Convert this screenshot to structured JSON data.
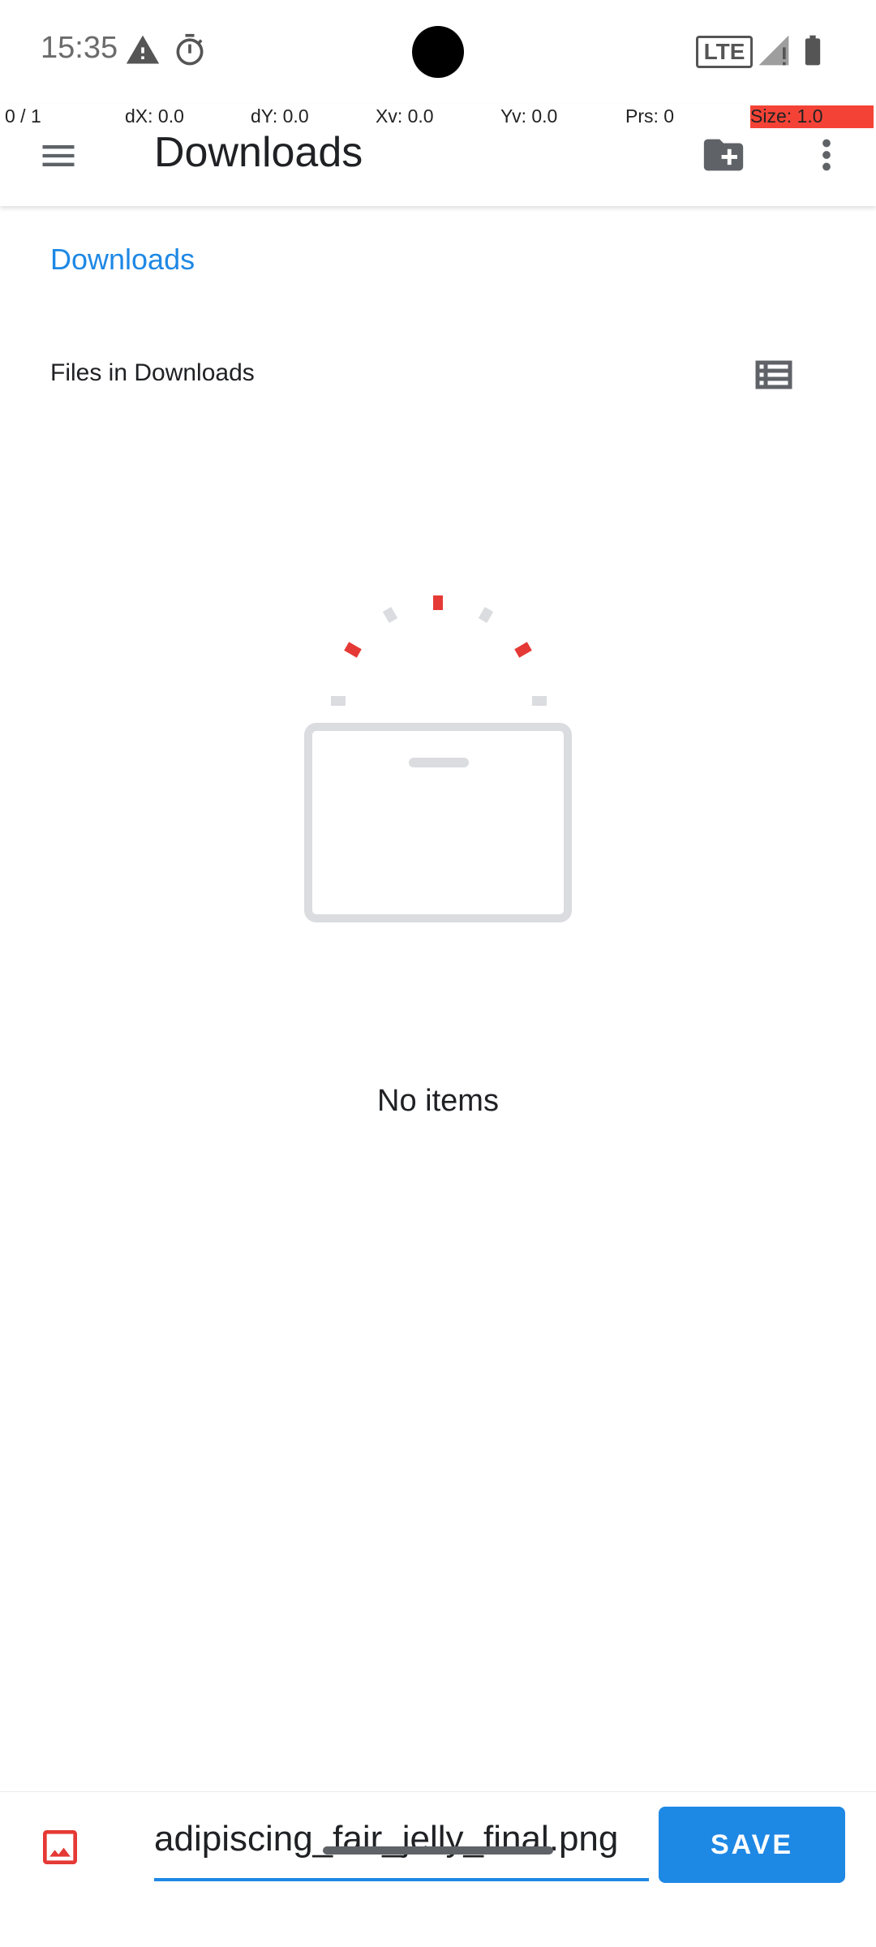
{
  "status_bar": {
    "time": "15:35",
    "network": "LTE",
    "icons": [
      "warning-icon",
      "timer-icon",
      "signal-icon",
      "battery-icon"
    ]
  },
  "pointer_overlay": {
    "pointer": "0 / 1",
    "dx": "dX: 0.0",
    "dy": "dY: 0.0",
    "xv": "Xv: 0.0",
    "yv": "Yv: 0.0",
    "prs": "Prs: 0",
    "size": "Size: 1.0"
  },
  "app_bar": {
    "title": "Downloads",
    "menu_icon": "menu-icon",
    "new_folder_icon": "create-new-folder-icon",
    "more_icon": "more-vert-icon"
  },
  "breadcrumb": {
    "label": "Downloads"
  },
  "list_header": {
    "label": "Files in Downloads",
    "view_icon": "list-view-icon"
  },
  "empty_state": {
    "text": "No items"
  },
  "save_bar": {
    "file_icon": "image-icon",
    "filename": "adipiscing_fair_jelly_final.png",
    "save_label": "SAVE"
  },
  "colors": {
    "accent": "#1e88e5",
    "illustration_red": "#e53935",
    "illustration_gray": "#dadce0",
    "size_bar": "#f44336"
  }
}
